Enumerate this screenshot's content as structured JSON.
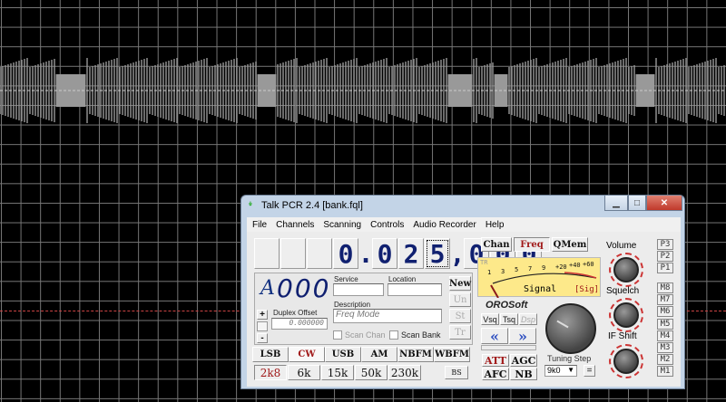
{
  "window": {
    "title": "Talk PCR 2.4 [bank.fql]",
    "minimize": "▁",
    "maximize": "□",
    "close": "✕"
  },
  "menu": [
    "File",
    "Channels",
    "Scanning",
    "Controls",
    "Audio Recorder",
    "Help"
  ],
  "frequency": {
    "digits": [
      "",
      "",
      "",
      "0",
      ".",
      "0",
      "2",
      "5",
      ",",
      "0",
      "0",
      "0"
    ]
  },
  "memory": {
    "bank": "A",
    "channel": "000",
    "service_label": "Service",
    "location_label": "Location",
    "service": "",
    "location": "",
    "description_label": "Description",
    "description_placeholder": "Freq Mode",
    "duplex_label": "Duplex Offset",
    "duplex_value": "0.000000",
    "plus": "+",
    "minus": "-",
    "scan_chan": "Scan Chan",
    "scan_bank": "Scan Bank",
    "side_buttons": [
      "New",
      "Un",
      "St",
      "Tr"
    ]
  },
  "modes": {
    "items": [
      "LSB",
      "CW",
      "USB",
      "AM",
      "NBFM",
      "WBFM"
    ],
    "selected": "CW"
  },
  "filters": {
    "items": [
      "2k8",
      "6k",
      "15k",
      "50k",
      "230k"
    ],
    "selected": "2k8",
    "bs": "BS"
  },
  "view_tabs": {
    "items": [
      "Chan",
      "Freq",
      "QMem"
    ],
    "selected": "Freq"
  },
  "meter": {
    "tr": "TR",
    "scale": [
      "1",
      "3",
      "5",
      "7",
      "9",
      "+20",
      "+40",
      "+60"
    ],
    "label": "Signal",
    "mode": "[Sig]",
    "level": 0
  },
  "brand": "OROSoft",
  "squelch_types": [
    "Vsq",
    "Tsq",
    "Dsp"
  ],
  "arrows": {
    "left": "«",
    "right": "»"
  },
  "toggles": [
    "ATT",
    "AGC",
    "AFC",
    "NB"
  ],
  "tuning": {
    "label": "Tuning Step",
    "value": "9k0",
    "equals": "="
  },
  "knobs": [
    "Volume",
    "Squelch",
    "IF Shift"
  ],
  "presets": [
    "P3",
    "P2",
    "P1"
  ],
  "memories": [
    "M8",
    "M7",
    "M6",
    "M5",
    "M4",
    "M3",
    "M2",
    "M1"
  ],
  "colors": {
    "accent_red": "#a01818",
    "digit_blue": "#102070",
    "meter_bg": "#fde98a"
  }
}
